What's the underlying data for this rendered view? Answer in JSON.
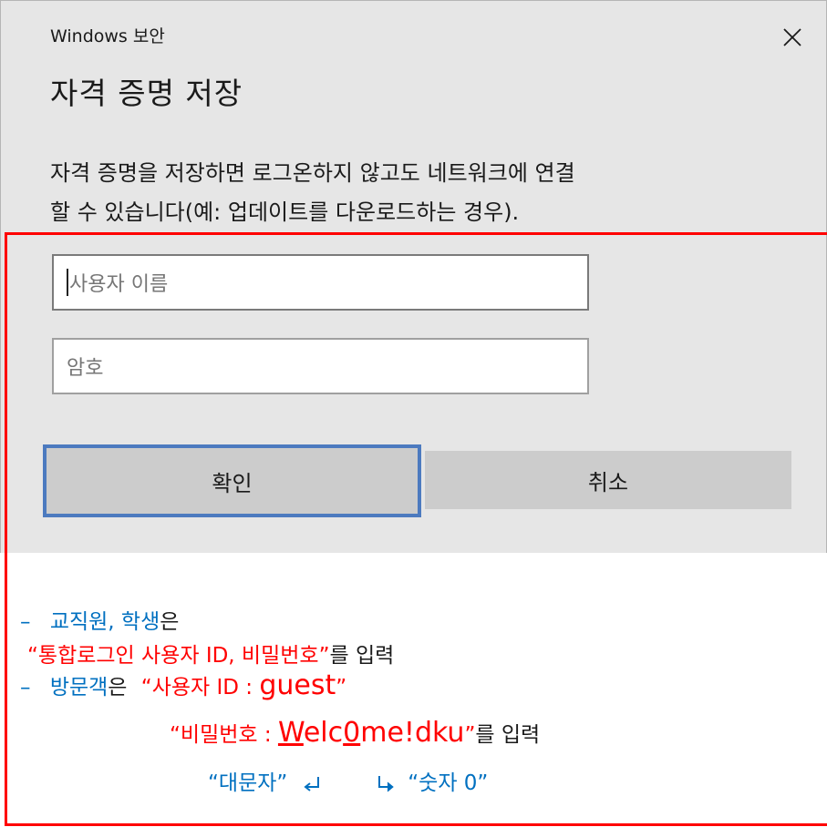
{
  "window": {
    "app_title": "Windows 보안",
    "heading": "자격 증명 저장",
    "description_line1": "자격 증명을 저장하면 로그온하지 않고도 네트워크에 연결",
    "description_line2": "할 수 있습니다(예: 업데이트를 다운로드하는 경우)."
  },
  "form": {
    "username_placeholder": "사용자 이름",
    "password_placeholder": "암호",
    "ok_label": "확인",
    "cancel_label": "취소"
  },
  "notes": {
    "dash1": "–",
    "staff_students": "교직원, 학생",
    "particle_eun1": "은",
    "sso_credentials": "“통합로그인 사용자 ID, 비밀번호”",
    "enter1": "를 입력",
    "dash2": "–",
    "visitor": "방문객",
    "particle_eun2": "은",
    "visitor_id_prefix": "“사용자 ID : ",
    "visitor_id_value": "guest",
    "visitor_id_suffix": "”",
    "pw_prefix": "“비밀번호  : ",
    "pw_W": "W",
    "pw_elc": "elc",
    "pw_0": "0",
    "pw_rest": "me!dku",
    "pw_suffix": "”",
    "enter2": "를 입력",
    "uppercase_hint": "“대문자”",
    "digit_hint": "“숫자 0”"
  },
  "colors": {
    "dialog_bg": "#e6e6e6",
    "highlight_border": "#ff0000",
    "focus_border": "#4c7abf",
    "blue_text": "#0070c0",
    "red_text": "#ff0000"
  }
}
